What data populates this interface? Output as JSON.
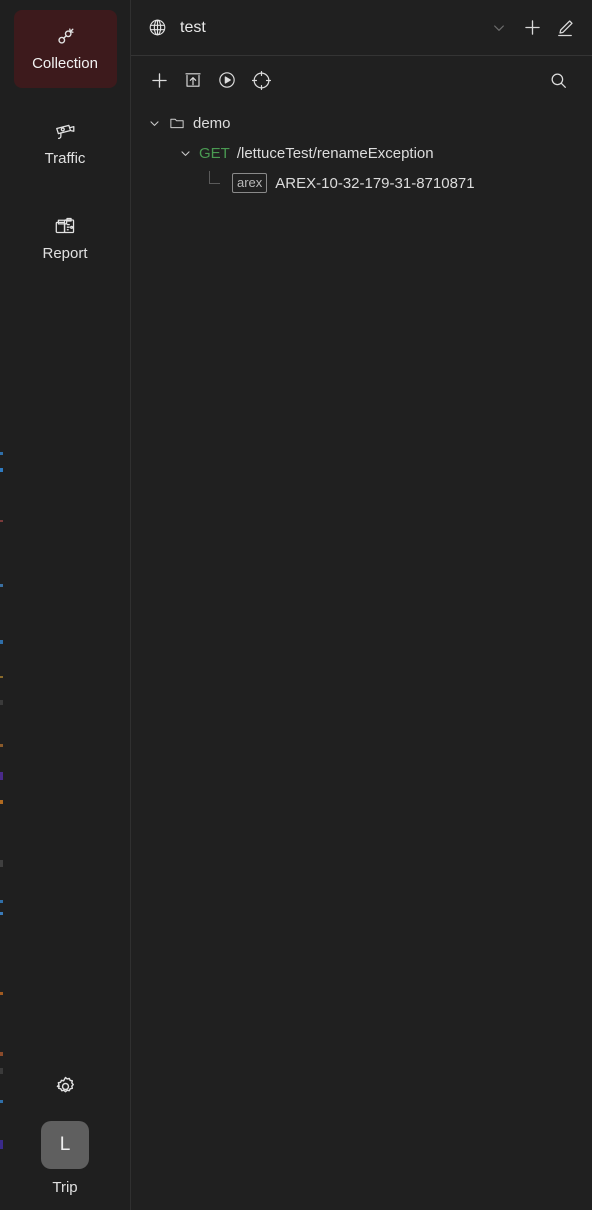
{
  "colors": {
    "app_bg": "#1f1f1f",
    "panel_bg": "#202020",
    "active_nav_bg": "#3d1a1c",
    "method_get": "#4a9a52",
    "avatar_bg": "#5f5f5f",
    "border": "#343434"
  },
  "sidebar": {
    "items": [
      {
        "label": "Collection",
        "icon": "api-link-icon",
        "active": true
      },
      {
        "label": "Traffic",
        "icon": "security-camera-icon",
        "active": false
      },
      {
        "label": "Report",
        "icon": "clipboard-report-icon",
        "active": false
      }
    ],
    "settings": {
      "icon": "gear-icon"
    },
    "user": {
      "avatar_initial": "L",
      "name": "Trip"
    }
  },
  "workspace_header": {
    "icon": "globe-icon",
    "title": "test",
    "actions": [
      {
        "name": "chevron-down-icon",
        "dim": true
      },
      {
        "name": "plus-icon",
        "dim": false
      },
      {
        "name": "edit-pencil-icon",
        "dim": false
      }
    ]
  },
  "toolbar": {
    "buttons": [
      {
        "name": "add-icon"
      },
      {
        "name": "import-icon"
      },
      {
        "name": "run-play-icon"
      },
      {
        "name": "focus-target-icon"
      }
    ],
    "search": {
      "name": "search-icon"
    }
  },
  "tree": {
    "folder": {
      "caret": "chevron-down",
      "icon": "folder-icon",
      "label": "demo"
    },
    "request": {
      "caret": "chevron-down",
      "method": "GET",
      "path": "/lettuceTest/renameException"
    },
    "case": {
      "tag": "arex",
      "label": "AREX-10-32-179-31-8710871"
    }
  }
}
